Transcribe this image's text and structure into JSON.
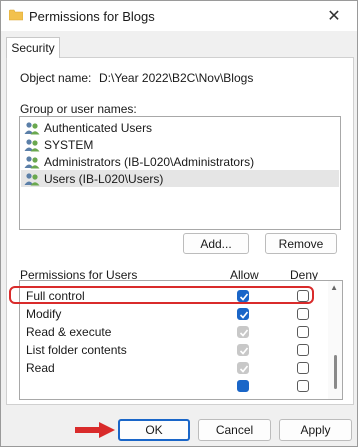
{
  "window": {
    "title": "Permissions for Blogs",
    "close_label": "✕"
  },
  "tabs": [
    {
      "label": "Security"
    }
  ],
  "object": {
    "label": "Object name:",
    "value": "D:\\Year 2022\\B2C\\Nov\\Blogs"
  },
  "groups": {
    "label": "Group or user names:",
    "items": [
      {
        "name": "Authenticated Users",
        "selected": false
      },
      {
        "name": "SYSTEM",
        "selected": false
      },
      {
        "name": "Administrators (IB-L020\\Administrators)",
        "selected": false
      },
      {
        "name": "Users (IB-L020\\Users)",
        "selected": true
      }
    ]
  },
  "buttons": {
    "add": "Add...",
    "remove": "Remove"
  },
  "permissions": {
    "label": "Permissions for Users",
    "allow_label": "Allow",
    "deny_label": "Deny",
    "rows": [
      {
        "name": "Full control",
        "allow": "checked",
        "deny": "empty"
      },
      {
        "name": "Modify",
        "allow": "checked",
        "deny": "empty"
      },
      {
        "name": "Read & execute",
        "allow": "grey",
        "deny": "empty"
      },
      {
        "name": "List folder contents",
        "allow": "grey",
        "deny": "empty"
      },
      {
        "name": "Read",
        "allow": "grey",
        "deny": "empty"
      }
    ]
  },
  "footer": {
    "ok": "OK",
    "cancel": "Cancel",
    "apply": "Apply"
  },
  "colors": {
    "accent": "#1a66c8",
    "highlight": "#d92b2b"
  }
}
